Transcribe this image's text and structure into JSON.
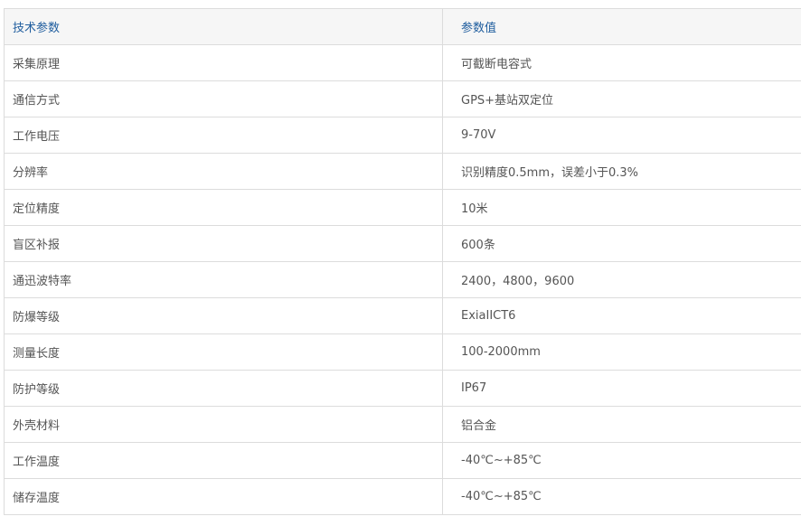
{
  "table": {
    "headers": [
      "技术参数",
      "参数值"
    ],
    "rows": [
      {
        "param": "采集原理",
        "value": "可截断电容式"
      },
      {
        "param": "通信方式",
        "value": "GPS+基站双定位"
      },
      {
        "param": "工作电压",
        "value": "9-70V"
      },
      {
        "param": "分辨率",
        "value": "识别精度0.5mm，误差小于0.3%"
      },
      {
        "param": "定位精度",
        "value": "10米"
      },
      {
        "param": "盲区补报",
        "value": "600条"
      },
      {
        "param": "通迅波特率",
        "value": "2400，4800，9600"
      },
      {
        "param": "防爆等级",
        "value": "ExiaIICT6"
      },
      {
        "param": "测量长度",
        "value": "100-2000mm"
      },
      {
        "param": "防护等级",
        "value": "IP67"
      },
      {
        "param": "外壳材料",
        "value": "铝合金"
      },
      {
        "param": "工作温度",
        "value": "-40℃~+85℃"
      },
      {
        "param": "储存温度",
        "value": "-40℃~+85℃"
      }
    ]
  },
  "colors": {
    "header_text": "#1f5d9e",
    "header_bg": "#f6f6f6",
    "body_text": "#555555",
    "border": "#dcdcdc"
  }
}
